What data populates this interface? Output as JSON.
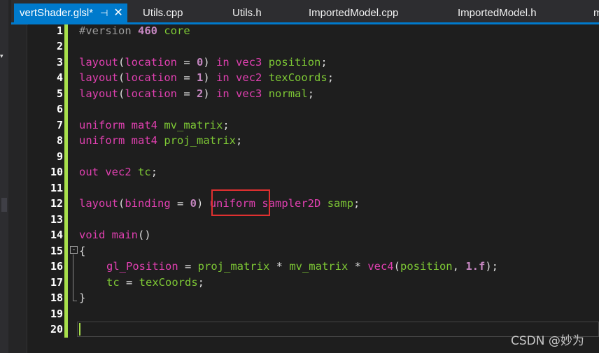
{
  "tabs": [
    {
      "label": "vertShader.glsl*",
      "active": true
    },
    {
      "label": "Utils.cpp",
      "active": false
    },
    {
      "label": "Utils.h",
      "active": false
    },
    {
      "label": "ImportedModel.cpp",
      "active": false
    },
    {
      "label": "ImportedModel.h",
      "active": false
    },
    {
      "label": "m",
      "active": false
    }
  ],
  "tab_pin_icon": "pin-icon",
  "tab_close_icon": "close-icon",
  "accent_color": "#007acc",
  "gutter_color": "#a8e04b",
  "line_numbers": [
    "1",
    "2",
    "3",
    "4",
    "5",
    "6",
    "7",
    "8",
    "9",
    "10",
    "11",
    "12",
    "13",
    "14",
    "15",
    "16",
    "17",
    "18",
    "19",
    "20"
  ],
  "code": {
    "l1": {
      "directive": "#version",
      "num": "460",
      "rest": "core"
    },
    "l3": {
      "a": "layout",
      "b": "(",
      "c": "location",
      "d": " = ",
      "e": "0",
      "f": ") ",
      "g": "in",
      "h": " ",
      "i": "vec3",
      "j": " ",
      "k": "position",
      "l": ";"
    },
    "l4": {
      "a": "layout",
      "b": "(",
      "c": "location",
      "d": " = ",
      "e": "1",
      "f": ") ",
      "g": "in",
      "h": " ",
      "i": "vec2",
      "j": " ",
      "k": "texCoords",
      "l": ";"
    },
    "l5": {
      "a": "layout",
      "b": "(",
      "c": "location",
      "d": " = ",
      "e": "2",
      "f": ") ",
      "g": "in",
      "h": " ",
      "i": "vec3",
      "j": " ",
      "k": "normal",
      "l": ";"
    },
    "l7": {
      "a": "uniform",
      "b": " ",
      "c": "mat4",
      "d": " ",
      "e": "mv_matrix",
      "f": ";"
    },
    "l8": {
      "a": "uniform",
      "b": " ",
      "c": "mat4",
      "d": " ",
      "e": "proj_matrix",
      "f": ";"
    },
    "l10": {
      "a": "out",
      "b": " ",
      "c": "vec2",
      "d": " ",
      "e": "tc",
      "f": ";"
    },
    "l12": {
      "a": "layout",
      "b": "(",
      "c": "binding",
      "d": " = ",
      "e": "0",
      "f": ") ",
      "g": "uniform",
      "h": " ",
      "i": "sampler2D",
      "j": " ",
      "k": "samp",
      "l": ";"
    },
    "l14": {
      "a": "void",
      "b": " ",
      "c": "main",
      "d": "()"
    },
    "l15": {
      "a": "{"
    },
    "l16": {
      "a": "gl_Position",
      "b": " = ",
      "c": "proj_matrix",
      "d": " * ",
      "e": "mv_matrix",
      "f": " * ",
      "g": "vec4",
      "h": "(",
      "i": "position",
      "j": ", ",
      "k": "1.f",
      "l": ");"
    },
    "l17": {
      "a": "tc",
      "b": " = ",
      "c": "texCoords",
      "d": ";"
    },
    "l18": {
      "a": "}"
    }
  },
  "fold_symbol": "-",
  "watermark": "CSDN @妙为"
}
